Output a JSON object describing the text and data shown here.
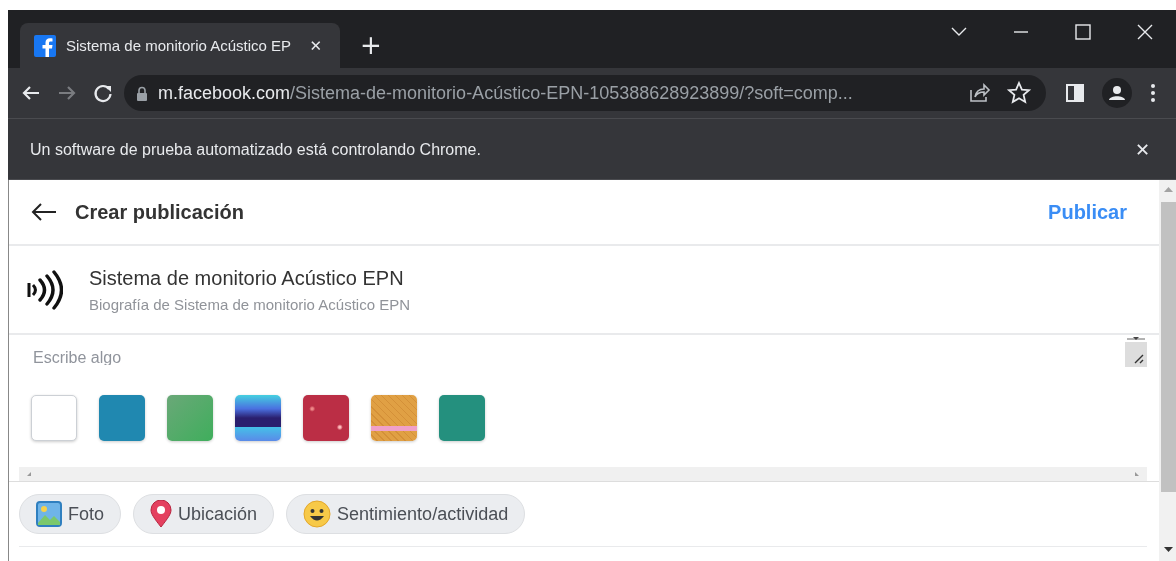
{
  "tab": {
    "title": "Sistema de monitorio Acústico EP",
    "close": "✕",
    "selected": true
  },
  "new_tab": "+",
  "address_bar": {
    "domain": "m.facebook.com",
    "path": "/Sistema-de-monitorio-Acústico-EPN-105388628923899/?soft=comp..."
  },
  "infobar": {
    "message": "Un software de prueba automatizado está controlando Chrome.",
    "close": "✕"
  },
  "header": {
    "title": "Crear publicación",
    "action": "Publicar"
  },
  "profile": {
    "name": "Sistema de monitorio Acústico EPN",
    "subtitle": "Biografía de Sistema de monitorio Acústico EPN"
  },
  "composer": {
    "placeholder": "Escribe algo"
  },
  "backgrounds": [
    {
      "kind": "solid",
      "color": "#ffffff"
    },
    {
      "kind": "solid",
      "color": "#2088b0"
    },
    {
      "kind": "gradient",
      "color": "#3fae5c"
    },
    {
      "kind": "stripes",
      "color": "#2a1f6e"
    },
    {
      "kind": "pattern",
      "color": "#bb2e45"
    },
    {
      "kind": "waffle",
      "color": "#e0a044"
    },
    {
      "kind": "solid",
      "color": "#24907e"
    }
  ],
  "actions": [
    {
      "kind": "photo",
      "label": "Foto"
    },
    {
      "kind": "location",
      "label": "Ubicación"
    },
    {
      "kind": "feeling",
      "label": "Sentimiento/actividad"
    }
  ]
}
